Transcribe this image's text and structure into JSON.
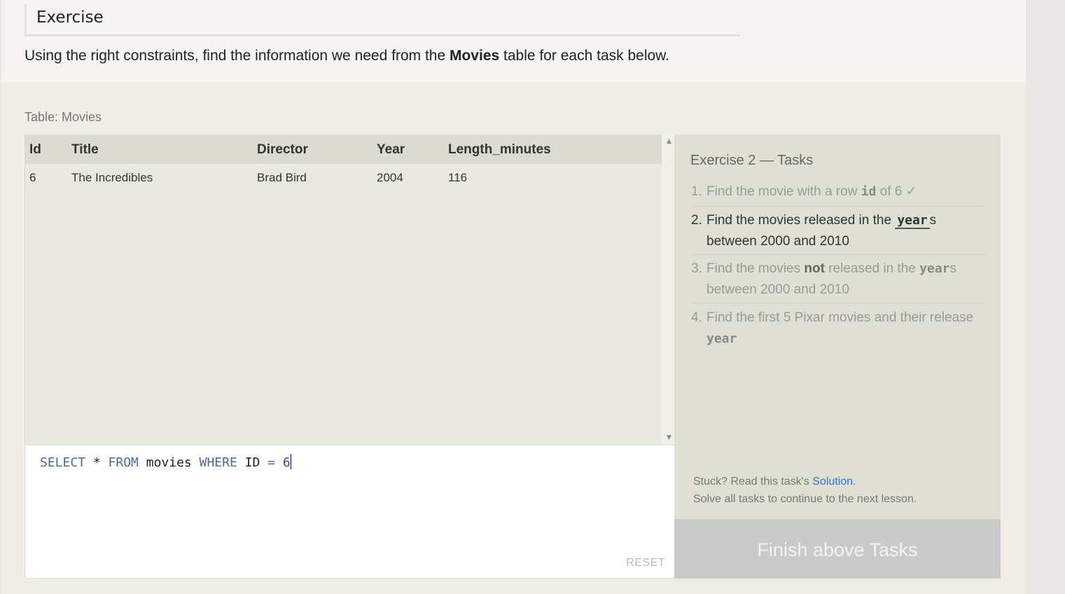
{
  "exercise": {
    "header": "Exercise",
    "intro_before": "Using the right constraints, find the information we need from the ",
    "intro_bold": "Movies",
    "intro_after": " table for each task below."
  },
  "table": {
    "label": "Table: Movies",
    "columns": [
      "Id",
      "Title",
      "Director",
      "Year",
      "Length_minutes"
    ],
    "rows": [
      [
        "6",
        "The Incredibles",
        "Brad Bird",
        "2004",
        "116"
      ]
    ]
  },
  "editor": {
    "query": "SELECT * FROM movies WHERE ID = 6",
    "tokens": {
      "select": "SELECT",
      "star": " * ",
      "from": "FROM",
      "table": " movies ",
      "where": "WHERE",
      "col": " ID ",
      "eq": "=",
      "space": " ",
      "val": "6"
    },
    "reset_label": "RESET"
  },
  "tasks": {
    "title": "Exercise 2 — Tasks",
    "items": [
      {
        "num": "1.",
        "pre": "Find the movie with a row ",
        "code": "id",
        "post": " of 6 ",
        "check": "✓",
        "state": "done"
      },
      {
        "num": "2.",
        "pre": "Find the movies released in the ",
        "code": "year",
        "post": "s between 2000 and 2010",
        "state": "active"
      },
      {
        "num": "3.",
        "pre": "Find the movies ",
        "bold": "not",
        "mid": " released in the ",
        "code": "year",
        "post": "s between 2000 and 2010",
        "state": "pending"
      },
      {
        "num": "4.",
        "pre": "Find the first 5 Pixar movies and their release ",
        "code": "year",
        "post": "",
        "state": "pending"
      }
    ],
    "stuck_prefix": "Stuck? Read this task's ",
    "solution_link": "Solution",
    "stuck_suffix": ".",
    "continue_note": "Solve all tasks to continue to the next lesson.",
    "finish_label": "Finish above Tasks"
  }
}
